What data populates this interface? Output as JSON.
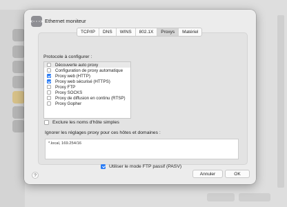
{
  "window": {
    "title": "Ethernet moniteur",
    "icon_text": "<···>"
  },
  "tabs": [
    {
      "label": "TCP/IP",
      "active": false
    },
    {
      "label": "DNS",
      "active": false
    },
    {
      "label": "WINS",
      "active": false
    },
    {
      "label": "802.1X",
      "active": false
    },
    {
      "label": "Proxys",
      "active": true
    },
    {
      "label": "Matériel",
      "active": false
    }
  ],
  "proxy": {
    "section_label": "Protocole à configurer :",
    "protocols": [
      {
        "label": "Découverte auto proxy",
        "checked": false,
        "selected": true
      },
      {
        "label": "Configuration de proxy automatique",
        "checked": false,
        "selected": false
      },
      {
        "label": "Proxy web (HTTP)",
        "checked": true,
        "selected": false
      },
      {
        "label": "Proxy web sécurisé (HTTPS)",
        "checked": true,
        "selected": false
      },
      {
        "label": "Proxy FTP",
        "checked": false,
        "selected": false
      },
      {
        "label": "Proxy SOCKS",
        "checked": false,
        "selected": false
      },
      {
        "label": "Proxy de diffusion en continu (RTSP)",
        "checked": false,
        "selected": false
      },
      {
        "label": "Proxy Gopher",
        "checked": false,
        "selected": false
      }
    ],
    "exclude_simple_label": "Exclure les noms d'hôte simples",
    "exclude_simple_checked": false,
    "bypass_label": "Ignorer les réglages proxy pour ces hôtes et domaines :",
    "bypass_value": "*.local, 169.254/16",
    "passive_ftp_label": "Utiliser le mode FTP passif (PASV)",
    "passive_ftp_checked": true
  },
  "footer": {
    "help_label": "?",
    "cancel_label": "Annuler",
    "ok_label": "OK"
  },
  "colors": {
    "accent": "#2a7cf5",
    "sheet_bg": "#ececec"
  }
}
